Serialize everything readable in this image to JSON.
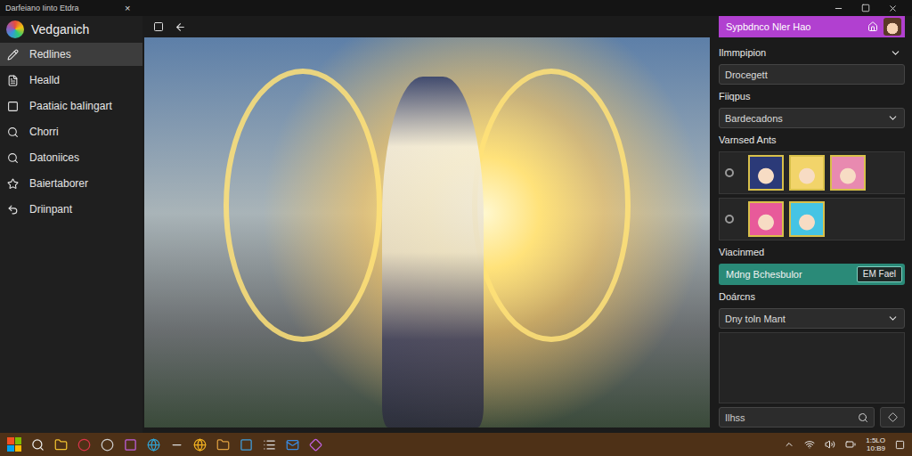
{
  "window": {
    "title": "Darfeiano Iinto Etdra",
    "close": "×"
  },
  "app": {
    "name": "Vedganich"
  },
  "sidebar": {
    "items": [
      {
        "label": "Redlines",
        "selected": true
      },
      {
        "label": "Healld",
        "selected": false
      },
      {
        "label": "Paatiaic baIingart",
        "selected": false
      },
      {
        "label": "Chorri",
        "selected": false
      },
      {
        "label": "Datoniices",
        "selected": false
      },
      {
        "label": "Baiertaborer",
        "selected": false
      },
      {
        "label": "Driinpant",
        "selected": false
      }
    ]
  },
  "panel": {
    "title": "Sypbdnco Nler Hao",
    "illumination": {
      "label": "Ilmmpipion",
      "value": "Drocegett"
    },
    "filters": {
      "label": "Fiiqpus",
      "value": "Bardecadons"
    },
    "variants": {
      "label": "Varnsed Ants",
      "groups": [
        {
          "selected": false,
          "thumbs": [
            {
              "color": "#2b3a78"
            },
            {
              "color": "#f2d46a"
            },
            {
              "color": "#e88ab0"
            }
          ]
        },
        {
          "selected": false,
          "thumbs": [
            {
              "color": "#e85a9a"
            },
            {
              "color": "#45c4e4"
            }
          ]
        }
      ]
    },
    "vaccinated": {
      "label": "Viacinmed",
      "value": "Mdng Bchesbulor",
      "button": "EM Fael"
    },
    "documents": {
      "label": "Doárcns",
      "value": "Dny toln Mant"
    },
    "search": {
      "placeholder": "Ilhss"
    }
  },
  "taskbar": {
    "tray": [
      "1:5LO",
      "10:B9"
    ]
  }
}
